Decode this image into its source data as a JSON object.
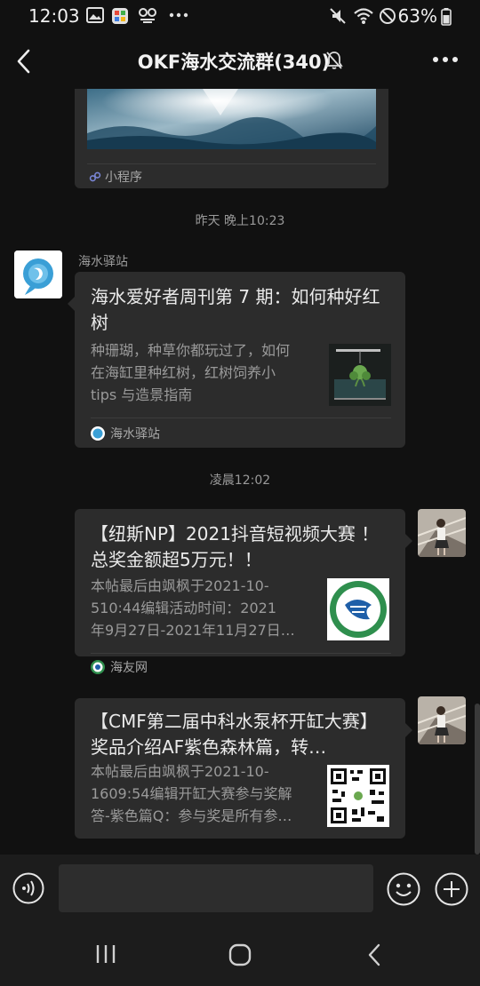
{
  "status_bar": {
    "time": "12:03",
    "battery_percent": "63%",
    "left_icons": [
      "image-icon",
      "app-icon",
      "tiktok-icon",
      "more-dots-icon"
    ],
    "right_icons": [
      "mute-icon",
      "wifi-icon",
      "dnd-icon",
      "battery-icon"
    ]
  },
  "header": {
    "title": "OKF海水交流群(340)",
    "muted": true
  },
  "messages": {
    "m0": {
      "source": "小程序"
    },
    "time1": "昨天 晚上10:23",
    "m1": {
      "sender": "海水驿站",
      "title": "海水爱好者周刊第 7 期：如何种好红树",
      "desc": [
        "种珊瑚，种草你都玩过了，如何",
        "在海缸里种红树，红树饲养小",
        "tips 与造景指南"
      ],
      "source": "海水驿站"
    },
    "time2": "凌晨12:02",
    "m2": {
      "title": "【纽斯NP】2021抖音短视频大赛 ！总奖金额超5万元！！",
      "desc": [
        "本帖最后由飒枫于2021-10-",
        "510:44编辑活动时间：2021",
        "年9月27日-2021年11月27日…"
      ],
      "source": "海友网"
    },
    "m3": {
      "title": "【CMF第二届中科水泵杯开缸大赛】奖品介绍AF紫色森林篇，转…",
      "desc": [
        "本帖最后由飒枫于2021-10-",
        "1609:54编辑开缸大赛参与奖解",
        "答-紫色篇Q：参与奖是所有参…"
      ]
    }
  },
  "input_bar": {
    "placeholder": ""
  },
  "colors": {
    "background": "#111111",
    "bubble": "#2c2c2c",
    "text_primary": "#eaeaea",
    "text_secondary": "#9a9a9a"
  }
}
